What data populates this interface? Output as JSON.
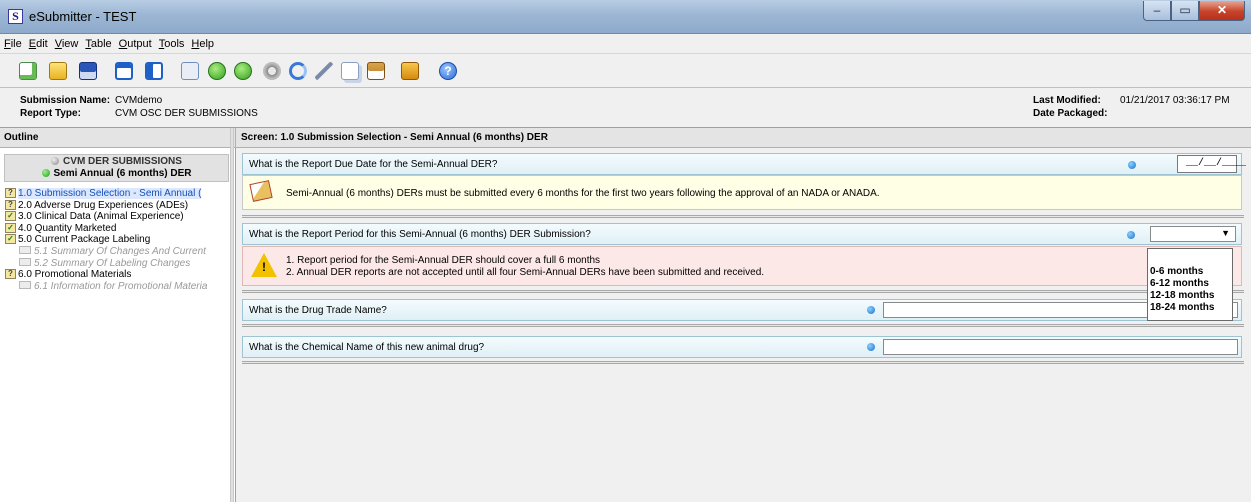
{
  "window": {
    "title": "eSubmitter - TEST",
    "app_icon_letter": "S"
  },
  "menu": [
    "File",
    "Edit",
    "View",
    "Table",
    "Output",
    "Tools",
    "Help"
  ],
  "info": {
    "submission_name_label": "Submission Name:",
    "submission_name": "CVMdemo",
    "report_type_label": "Report Type:",
    "report_type": "CVM OSC DER SUBMISSIONS",
    "last_modified_label": "Last Modified:",
    "last_modified": "01/21/2017 03:36:17 PM",
    "date_packaged_label": "Date Packaged:"
  },
  "outline": {
    "header": "Outline",
    "group_title": "CVM DER SUBMISSIONS",
    "group_subtitle": "Semi Annual (6 months) DER",
    "items": [
      {
        "label": "1.0 Submission Selection - Semi Annual (",
        "status": "?"
      },
      {
        "label": "2.0 Adverse Drug Experiences (ADEs)",
        "status": "?"
      },
      {
        "label": "3.0 Clinical Data (Animal Experience)",
        "status": "✓"
      },
      {
        "label": "4.0 Quantity Marketed",
        "status": "✓"
      },
      {
        "label": "5.0 Current Package Labeling",
        "status": "✓"
      },
      {
        "label": "5.1 Summary Of Changes And Current"
      },
      {
        "label": "5.2 Summary Of Labeling Changes"
      },
      {
        "label": "6.0 Promotional Materials",
        "status": "?"
      },
      {
        "label": "6.1 Information for Promotional Materia"
      }
    ]
  },
  "screen": {
    "header": "Screen: 1.0 Submission Selection - Semi Annual (6 months) DER",
    "q1": "What is the Report Due Date for the Semi-Annual DER?",
    "q1_value": "__/__/____",
    "note1": "Semi-Annual (6 months) DERs must be submitted every 6 months for the first two years following the approval of an NADA or ANADA.",
    "q2": "What is the Report Period for this Semi-Annual (6 months) DER Submission?",
    "warn1": "1. Report period for the Semi-Annual DER should cover a full 6 months",
    "warn2": "2. Annual DER reports are not accepted until all four Semi-Annual DERs have been submitted and received.",
    "q3": "What is the Drug Trade Name?",
    "q4": "What is the Chemical Name of this new animal drug?",
    "dropdown_options": [
      "0-6 months",
      "6-12 months",
      "12-18 months",
      "18-24 months"
    ]
  }
}
